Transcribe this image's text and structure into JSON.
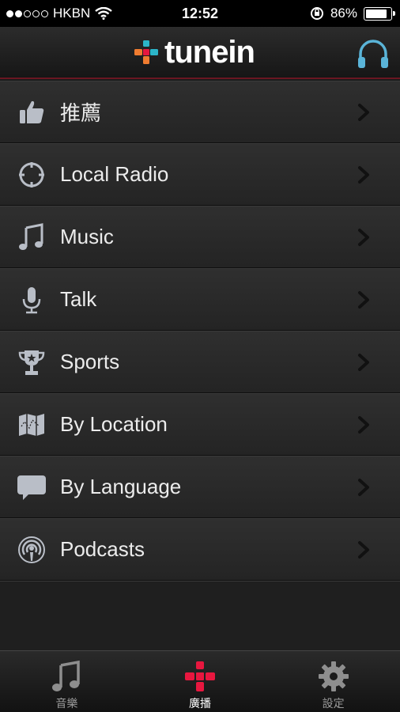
{
  "status_bar": {
    "signal_dots": [
      true,
      true,
      false,
      false,
      false
    ],
    "carrier": "HKBN",
    "time": "12:52",
    "battery_percent": "86%",
    "battery_level": 0.86
  },
  "header": {
    "logo_text": "tunein",
    "right_icon": "headphones-icon"
  },
  "menu": [
    {
      "label": "推薦",
      "icon": "thumbs-up-icon"
    },
    {
      "label": "Local Radio",
      "icon": "crosshair-icon"
    },
    {
      "label": "Music",
      "icon": "music-note-icon"
    },
    {
      "label": "Talk",
      "icon": "microphone-icon"
    },
    {
      "label": "Sports",
      "icon": "trophy-icon"
    },
    {
      "label": "By Location",
      "icon": "map-icon"
    },
    {
      "label": "By Language",
      "icon": "speech-bubble-icon"
    },
    {
      "label": "Podcasts",
      "icon": "podcast-icon"
    }
  ],
  "tabs": [
    {
      "label": "音樂",
      "icon": "music-note-icon",
      "active": false
    },
    {
      "label": "廣播",
      "icon": "tunein-plus-icon",
      "active": true
    },
    {
      "label": "設定",
      "icon": "gear-icon",
      "active": false
    }
  ],
  "colors": {
    "accent_red": "#e8173f",
    "header_divider": "#6a1621",
    "logo_orange": "#f07c30",
    "logo_teal": "#2cb5c9"
  }
}
